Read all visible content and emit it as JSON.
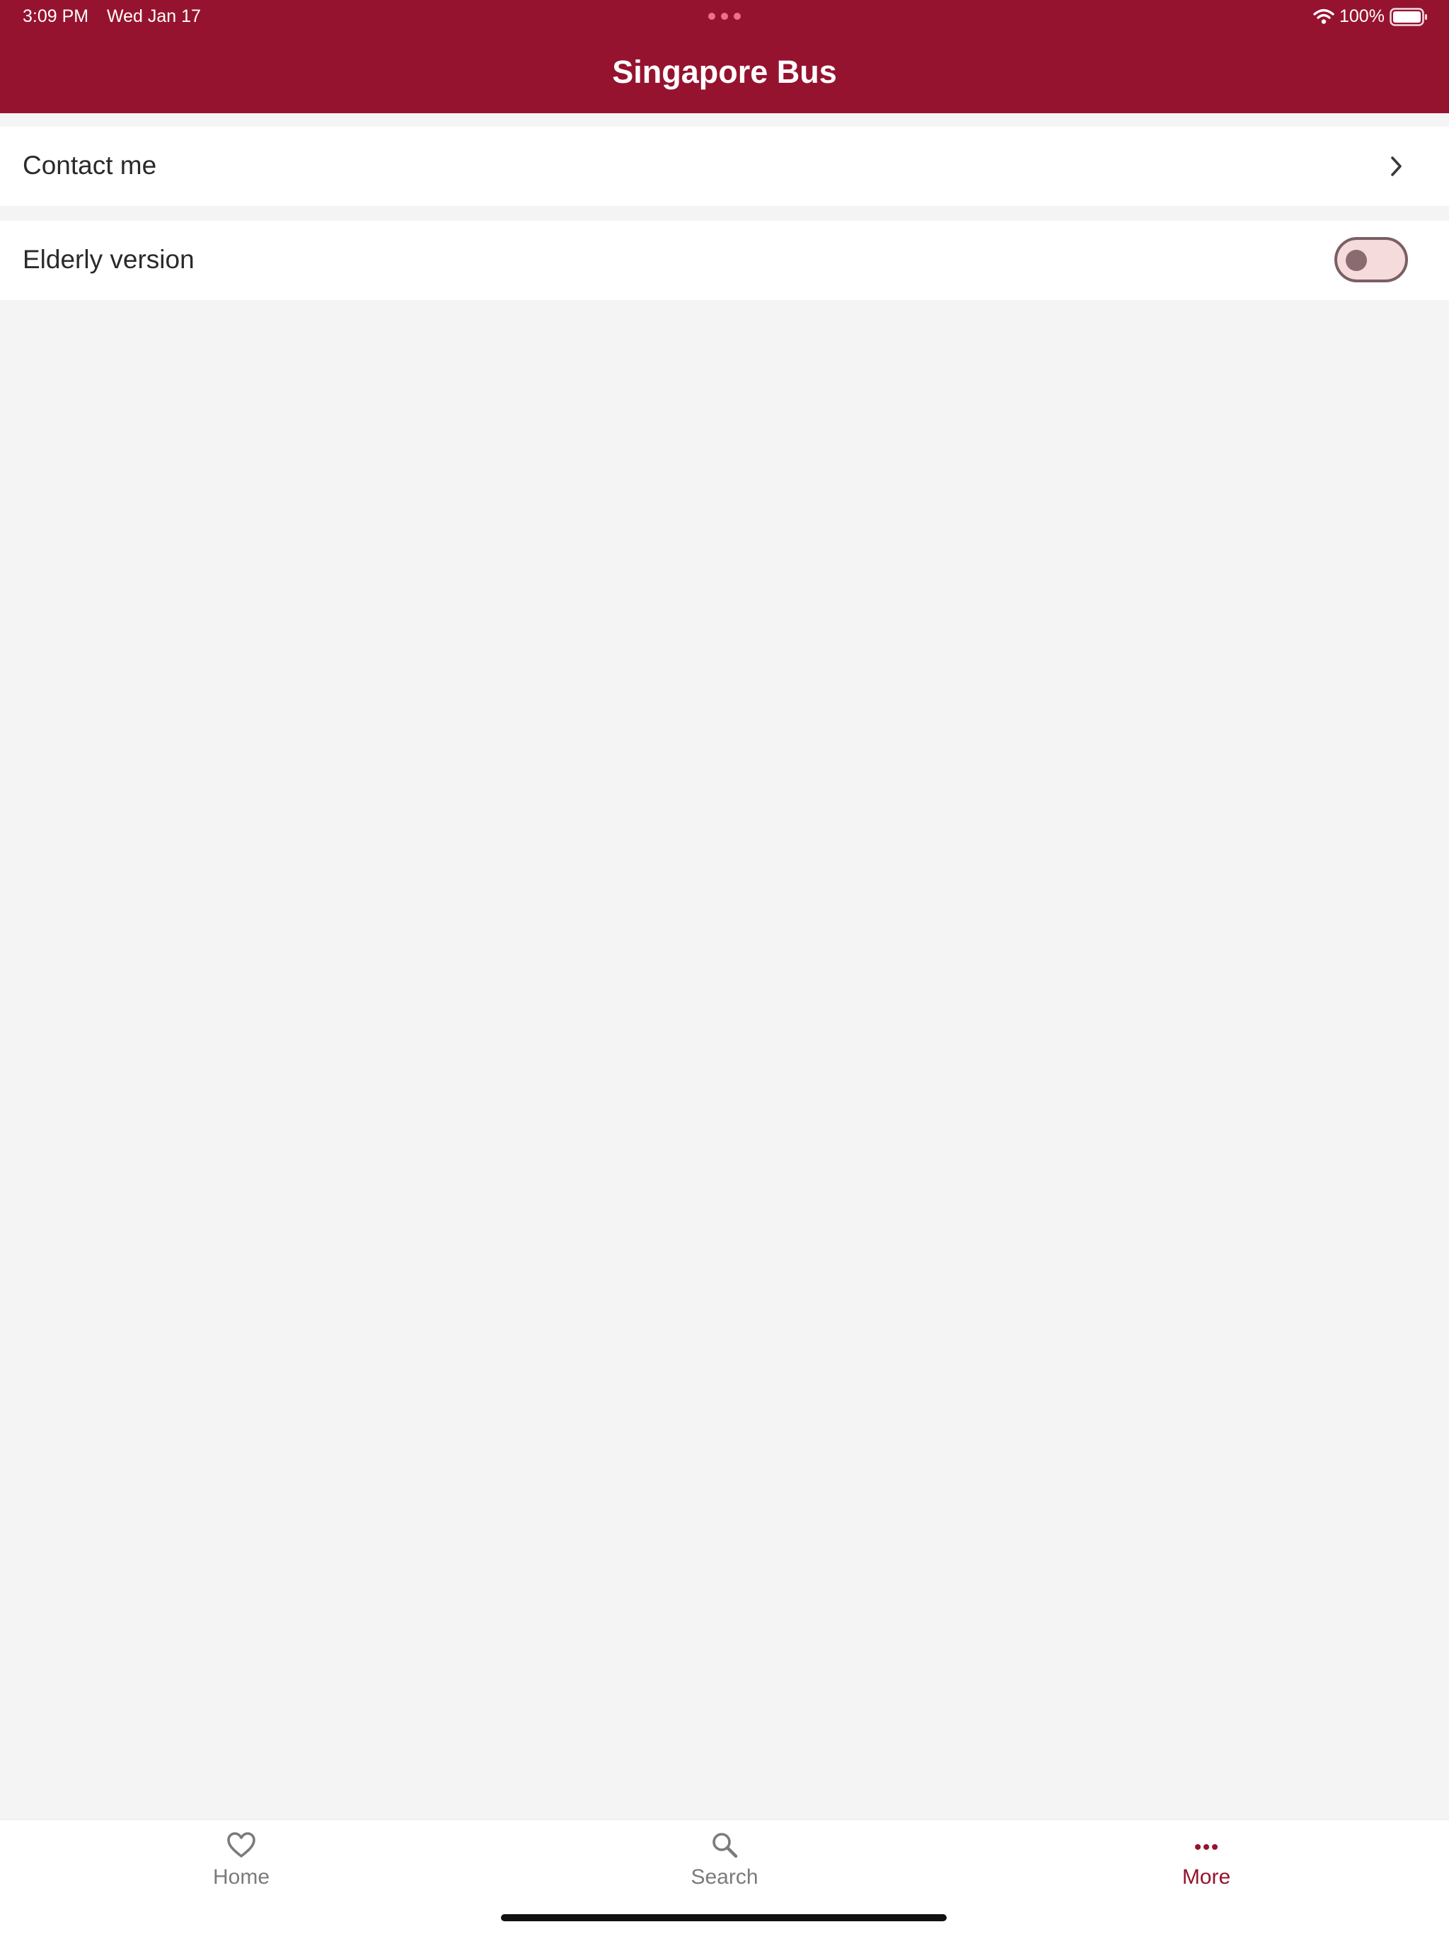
{
  "status_bar": {
    "time": "3:09 PM",
    "date": "Wed Jan 17",
    "battery": "100%"
  },
  "nav": {
    "title": "Singapore Bus"
  },
  "settings": {
    "contact_label": "Contact me",
    "elderly_label": "Elderly version",
    "elderly_enabled": false
  },
  "tabs": [
    {
      "label": "Home",
      "icon": "heart-icon",
      "active": false
    },
    {
      "label": "Search",
      "icon": "search-icon",
      "active": false
    },
    {
      "label": "More",
      "icon": "more-icon",
      "active": true
    }
  ],
  "colors": {
    "brand": "#96132f",
    "inactive_tab": "#7b7b7b",
    "toggle_track": "#f6dbdd",
    "toggle_border": "#7a5f63"
  }
}
